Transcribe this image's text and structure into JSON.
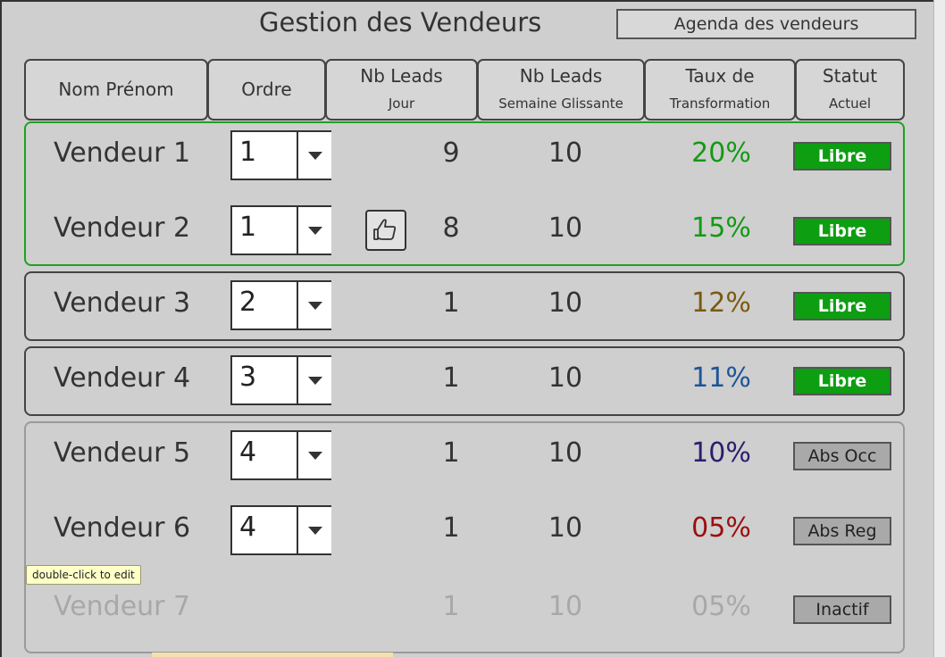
{
  "title": "Gestion des Vendeurs",
  "agenda_button": "Agenda des vendeurs",
  "headers": {
    "nom": "Nom Prénom",
    "ordre": "Ordre",
    "nb_jour_l1": "Nb Leads",
    "nb_jour_l2": "Jour",
    "nb_sem_l1": "Nb Leads",
    "nb_sem_l2": "Semaine Glissante",
    "taux_l1": "Taux de",
    "taux_l2": "Transformation",
    "statut_l1": "Statut",
    "statut_l2": "Actuel"
  },
  "rows": [
    {
      "name": "Vendeur 1",
      "ordre": "1",
      "jour": "9",
      "semaine": "10",
      "taux": "20%",
      "statut": "Libre"
    },
    {
      "name": "Vendeur 2",
      "ordre": "1",
      "jour": "8",
      "semaine": "10",
      "taux": "15%",
      "statut": "Libre"
    },
    {
      "name": "Vendeur 3",
      "ordre": "2",
      "jour": "1",
      "semaine": "10",
      "taux": "12%",
      "statut": "Libre"
    },
    {
      "name": "Vendeur 4",
      "ordre": "3",
      "jour": "1",
      "semaine": "10",
      "taux": "11%",
      "statut": "Libre"
    },
    {
      "name": "Vendeur 5",
      "ordre": "4",
      "jour": "1",
      "semaine": "10",
      "taux": "10%",
      "statut": "Abs Occ"
    },
    {
      "name": "Vendeur 6",
      "ordre": "4",
      "jour": "1",
      "semaine": "10",
      "taux": "05%",
      "statut": "Abs Reg"
    },
    {
      "name": "Vendeur 7",
      "jour": "1",
      "semaine": "10",
      "taux": "05%",
      "statut": "Inactif"
    }
  ],
  "tooltip": "double-click to edit",
  "colors": {
    "green_border": "#1ea21e",
    "libre_bg": "#0d9e12",
    "rate_20": "#129a12",
    "rate_15": "#129a12",
    "rate_12": "#7a5a10",
    "rate_11": "#1d5596",
    "rate_10": "#2a1e6c",
    "rate_05": "#9a0f0f",
    "rate_inactive": "#a8a8a8"
  },
  "icons": {
    "thumb": "thumb-up-icon",
    "dropdown": "chevron-down-icon"
  }
}
